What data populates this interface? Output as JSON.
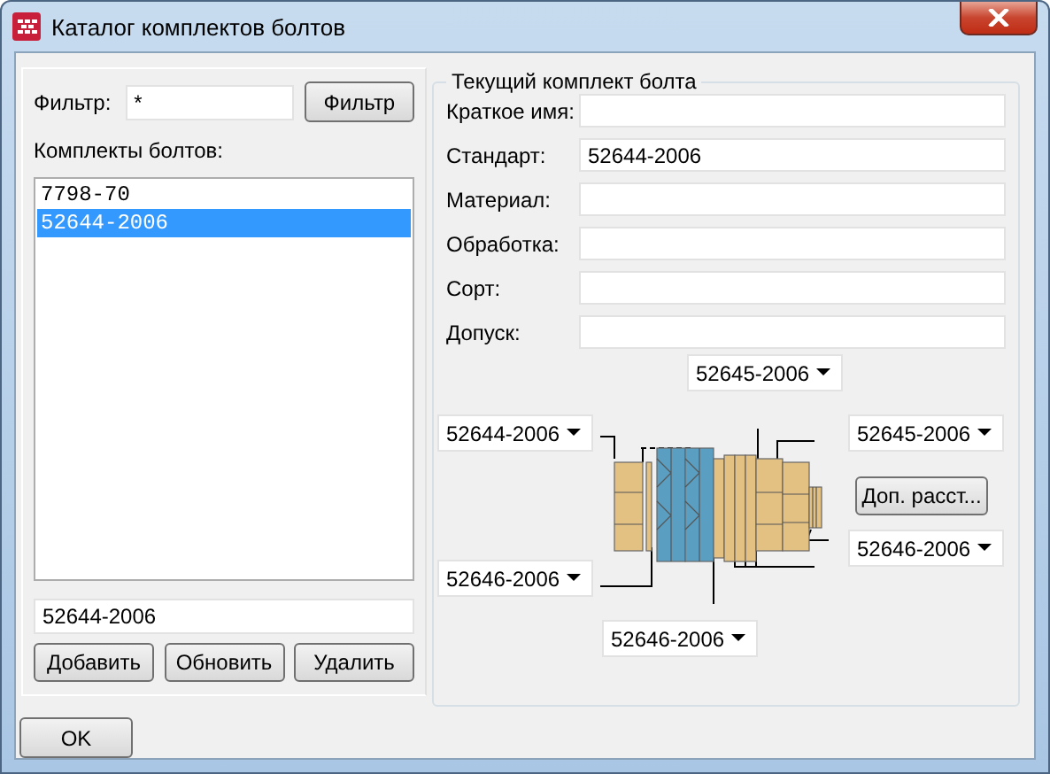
{
  "window": {
    "title": "Каталог комплектов болтов"
  },
  "filter": {
    "label": "Фильтр:",
    "value": "*",
    "button": "Фильтр"
  },
  "sets": {
    "label": "Комплекты болтов:",
    "items": [
      {
        "text": "7798-70",
        "selected": false
      },
      {
        "text": "52644-2006",
        "selected": true
      }
    ]
  },
  "new_value": "52644-2006",
  "list_buttons": [
    "Добавить",
    "Обновить",
    "Удалить"
  ],
  "group": {
    "title": "Текущий комплект болта",
    "fields": [
      {
        "label": "Краткое имя:"
      },
      {
        "label": "Стандарт:",
        "value": "52644-2006"
      },
      {
        "label": "Материал:"
      },
      {
        "label": "Обработка:"
      },
      {
        "label": "Сорт:"
      },
      {
        "label": "Допуск:"
      }
    ]
  },
  "diagram": {
    "combos": [
      {
        "kind": "top",
        "value": "52645-2006"
      },
      {
        "kind": "left",
        "value": "52644-2006"
      },
      {
        "kind": "right",
        "value": "52645-2006"
      },
      {
        "kind": "right_bottom",
        "value": "52646-2006"
      },
      {
        "kind": "left_bottom",
        "value": "52646-2006"
      },
      {
        "kind": "bottom",
        "value": "52646-2006"
      }
    ],
    "extra_button": "Доп. расст..."
  },
  "ok_button": "OK"
}
